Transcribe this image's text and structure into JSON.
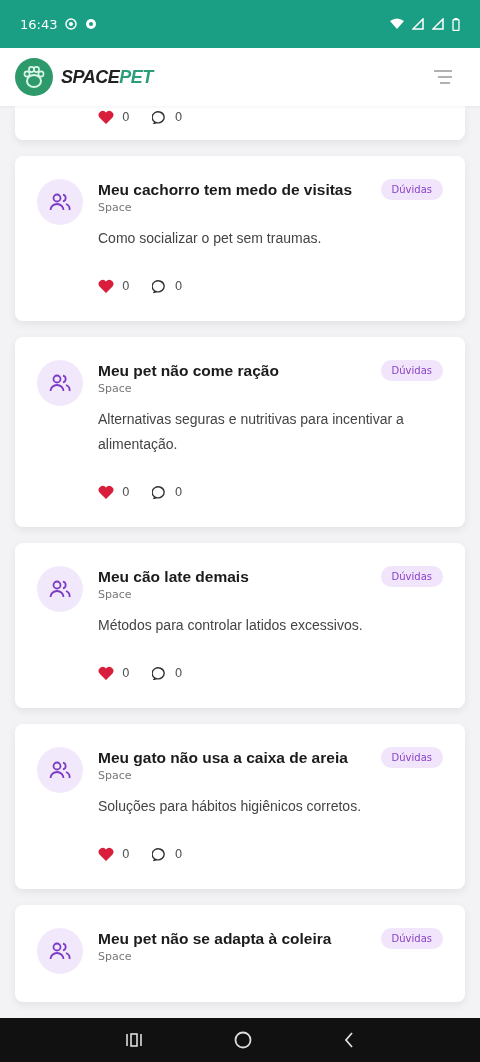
{
  "status_bar": {
    "time": "16:43"
  },
  "header": {
    "brand_a": "SPACE",
    "brand_b": "PET"
  },
  "partial_post": {
    "likes": "0",
    "comments": "0"
  },
  "posts": [
    {
      "title": "Meu cachorro tem medo de visitas",
      "space": "Space",
      "description": "Como socializar o pet sem traumas.",
      "tag": "Dúvidas",
      "likes": "0",
      "comments": "0"
    },
    {
      "title": "Meu pet não come ração",
      "space": "Space",
      "description": "Alternativas seguras e nutritivas para incentivar a alimentação.",
      "tag": "Dúvidas",
      "likes": "0",
      "comments": "0"
    },
    {
      "title": "Meu cão late demais",
      "space": "Space",
      "description": "Métodos para controlar latidos excessivos.",
      "tag": "Dúvidas",
      "likes": "0",
      "comments": "0"
    },
    {
      "title": "Meu gato não usa a caixa de areia",
      "space": "Space",
      "description": "Soluções para hábitos higiênicos corretos.",
      "tag": "Dúvidas",
      "likes": "0",
      "comments": "0"
    },
    {
      "title": "Meu pet não se adapta à coleira",
      "space": "Space",
      "tag": "Dúvidas"
    }
  ]
}
